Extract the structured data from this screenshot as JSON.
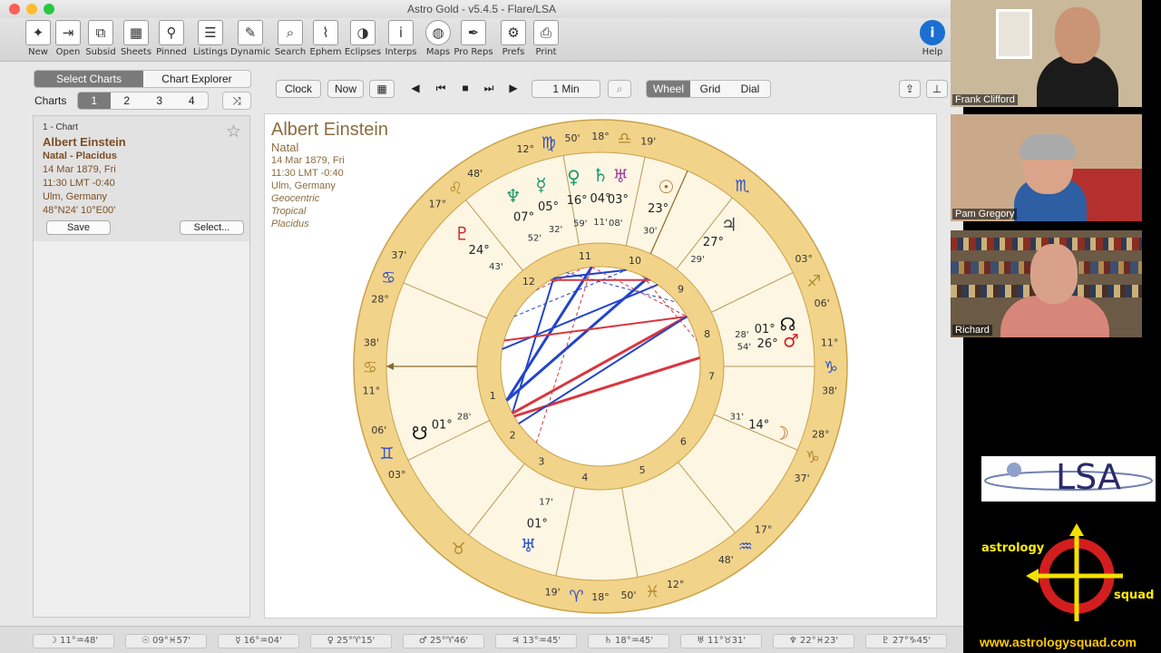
{
  "window": {
    "title": "Astro Gold - v5.4.5 - Flare/LSA"
  },
  "toolbar": {
    "items": [
      {
        "label": "New",
        "icon": "new-chart-icon",
        "glyph": "✦"
      },
      {
        "label": "Open",
        "icon": "open-icon",
        "glyph": "⇥"
      },
      {
        "label": "Subsid",
        "icon": "subsid-icon",
        "glyph": "⧉"
      },
      {
        "label": "Sheets",
        "icon": "sheets-icon",
        "glyph": "▦"
      },
      {
        "label": "Pinned",
        "icon": "pin-icon",
        "glyph": "⚲"
      },
      {
        "label": "Listings",
        "icon": "listings-icon",
        "glyph": "☰"
      },
      {
        "label": "Dynamic",
        "icon": "dynamic-icon",
        "glyph": "✎"
      },
      {
        "label": "Search",
        "icon": "search-icon",
        "glyph": "⌕"
      },
      {
        "label": "Ephem",
        "icon": "ephem-icon",
        "glyph": "⌇"
      },
      {
        "label": "Eclipses",
        "icon": "eclipses-icon",
        "glyph": "◑"
      },
      {
        "label": "Interps",
        "icon": "interps-icon",
        "glyph": "i"
      },
      {
        "label": "Maps",
        "icon": "globe-icon",
        "glyph": "◍"
      },
      {
        "label": "Pro Reps",
        "icon": "pro-reps-icon",
        "glyph": "✒"
      },
      {
        "label": "Prefs",
        "icon": "gear-icon",
        "glyph": "⚙"
      },
      {
        "label": "Print",
        "icon": "printer-icon",
        "glyph": "⎙"
      }
    ],
    "help": {
      "label": "Help",
      "icon": "info-icon",
      "glyph": "i"
    }
  },
  "left": {
    "tabs": [
      "Select Charts",
      "Chart Explorer"
    ],
    "charts_label": "Charts",
    "chart_slots": [
      "1",
      "2",
      "3",
      "4"
    ],
    "shuffle_glyph": "⤨",
    "card": {
      "index": "1 - Chart",
      "name": "Albert Einstein",
      "type": "Natal - Placidus",
      "date": "14 Mar 1879, Fri",
      "time": "11:30 LMT -0:40",
      "place": "Ulm, Germany",
      "coords": "48°N24' 10°E00'",
      "star": "☆",
      "save": "Save",
      "select": "Select..."
    }
  },
  "controls": {
    "clock": "Clock",
    "now": "Now",
    "calendar_glyph": "▦",
    "prev_glyph": "◀",
    "first_glyph": "⏮",
    "stop_glyph": "■",
    "last_glyph": "⏭",
    "play_glyph": "▶",
    "step": "1 Min",
    "zoom_glyph": "⌕",
    "views": [
      "Wheel",
      "Grid",
      "Dial"
    ],
    "share_glyph": "⇪",
    "pin_glyph": "⊥"
  },
  "chart": {
    "title": "Albert Einstein",
    "subtitle": "Natal",
    "date": "14 Mar 1879, Fri",
    "time": "11:30 LMT -0:40",
    "place": "Ulm, Germany",
    "zodiac": [
      "Geocentric",
      "Tropical",
      "Placidus"
    ],
    "cusps": [
      {
        "deg": "11°",
        "sign": "♋",
        "min": "38'"
      },
      {
        "deg": "28°",
        "sign": "♋",
        "min": "37'"
      },
      {
        "deg": "17°",
        "sign": "♌",
        "min": "48'"
      },
      {
        "deg": "12°",
        "sign": "♍",
        "min": "50'"
      },
      {
        "deg": "18°",
        "sign": "♎",
        "min": "19'"
      },
      {
        "deg": "",
        "sign": "♏",
        "min": ""
      },
      {
        "deg": "03°",
        "sign": "♐",
        "min": "06'"
      },
      {
        "deg": "11°",
        "sign": "♑",
        "min": "38'"
      },
      {
        "deg": "28°",
        "sign": "♑",
        "min": "37'"
      },
      {
        "deg": "17°",
        "sign": "♒",
        "min": "48'"
      },
      {
        "deg": "12°",
        "sign": "♓",
        "min": "50'"
      },
      {
        "deg": "18°",
        "sign": "♈",
        "min": "19'"
      },
      {
        "deg": "",
        "sign": "♉",
        "min": ""
      },
      {
        "deg": "03°",
        "sign": "♊",
        "min": "06'"
      }
    ],
    "houses": [
      "1",
      "2",
      "3",
      "4",
      "5",
      "6",
      "7",
      "8",
      "9",
      "10",
      "11",
      "12"
    ],
    "planets": [
      {
        "glyph": "♀",
        "color": "#1a9a6a",
        "deg": "16°",
        "min": "59'"
      },
      {
        "glyph": "♄",
        "color": "#1a9a6a",
        "deg": "04°",
        "min": "11'"
      },
      {
        "glyph": "♅",
        "color": "#a23ca0",
        "deg": "03°",
        "min": "08'"
      },
      {
        "glyph": "☉",
        "color": "#b5651d",
        "deg": "23°",
        "min": "30'"
      },
      {
        "glyph": "♃",
        "color": "#444444",
        "deg": "27°",
        "min": "29'"
      },
      {
        "glyph": "☊",
        "color": "#111111",
        "deg": "01°",
        "min": "28'"
      },
      {
        "glyph": "♂",
        "color": "#d22222",
        "deg": "26°",
        "min": "54'"
      },
      {
        "glyph": "☽",
        "color": "#b5651d",
        "deg": "14°",
        "min": "31'"
      },
      {
        "glyph": "♅",
        "color": "#2a4fcc",
        "deg": "01°",
        "min": "17'"
      },
      {
        "glyph": "☋",
        "color": "#111111",
        "deg": "01°",
        "min": "28'"
      },
      {
        "glyph": "♇",
        "color": "#c8202b",
        "deg": "24°",
        "min": "43'"
      },
      {
        "glyph": "♆",
        "color": "#1a9a6a",
        "deg": "07°",
        "min": "52'"
      },
      {
        "glyph": "☿",
        "color": "#1a9a6a",
        "deg": "05°",
        "min": "32'"
      }
    ]
  },
  "status": [
    "☽ 11°♒48'",
    "☉ 09°♓57'",
    "☿ 16°♒04'",
    "♀ 25°♈15'",
    "♂ 25°♈46'",
    "♃ 13°♒45'",
    "♄ 18°♒45'",
    "♅ 11°♉31'",
    "♆ 22°♓23'",
    "♇ 27°♑45'"
  ],
  "video": {
    "participants": [
      "Frank Clifford",
      "Pam Gregory",
      "Richard"
    ]
  },
  "branding": {
    "lsa": "LSA",
    "astrology": "astrology",
    "squad": "squad",
    "url": "www.astrologysquad.com"
  },
  "colors": {
    "wheel_gold": "#f2d38a",
    "wheel_border": "#c9a24a",
    "aspect_red": "#d9363e",
    "aspect_blue": "#2244cc"
  }
}
